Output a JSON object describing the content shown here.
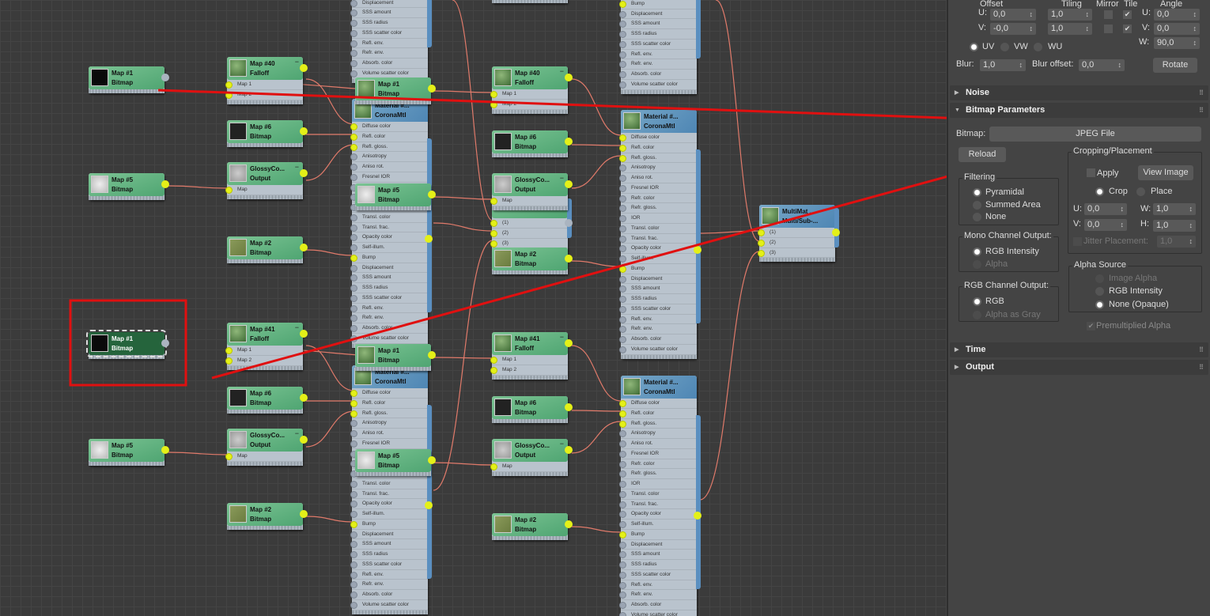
{
  "graph": {
    "material_ports": [
      "Diffuse color",
      "Refl. color",
      "Refl. gloss.",
      "Anisotropy",
      "Aniso rot.",
      "Fresnel IOR",
      "Refr. color",
      "Refr. gloss.",
      "IOR",
      "Transl. color",
      "Transl. frac.",
      "Opacity color",
      "Self-illum.",
      "Bump",
      "Displacement",
      "SSS amount",
      "SSS radius",
      "SSS scatter color",
      "Refl. env.",
      "Refr. env.",
      "Absorb. color",
      "Volume scatter color"
    ],
    "material": {
      "title": "Material #...",
      "subtitle": "CoronaMtl"
    },
    "map1": {
      "title": "Map #1",
      "subtitle": "Bitmap"
    },
    "map5": {
      "title": "Map #5",
      "subtitle": "Bitmap"
    },
    "map6": {
      "title": "Map #6",
      "subtitle": "Bitmap"
    },
    "map2": {
      "title": "Map #2",
      "subtitle": "Bitmap"
    },
    "map40": {
      "title": "Map #40",
      "subtitle": "Falloff",
      "ports": [
        "Map 1",
        "Map 2"
      ]
    },
    "map41": {
      "title": "Map #41",
      "subtitle": "Falloff",
      "ports": [
        "Map 1",
        "Map 2"
      ]
    },
    "glossy": {
      "title": "GlossyCo...",
      "subtitle": "Output",
      "ports": [
        "Map"
      ]
    },
    "multi_ports": [
      "(1)",
      "(2)",
      "(3)"
    ],
    "multimat": {
      "title": "MultiMat ...",
      "subtitle": "Multi/Sub-...",
      "ports": [
        "(1)",
        "(2)",
        "(3)"
      ]
    },
    "wire_color": "#e07a6a",
    "annotation_color": "#e01010"
  },
  "panel": {
    "coords": {
      "offset": "Offset",
      "tiling": "Tiling",
      "mirror": "Mirror",
      "tile": "Tile",
      "angle": "Angle",
      "u_label": "U:",
      "v_label": "V:",
      "w_label": "W:",
      "u_offset": "0,0",
      "v_offset": "-0,0",
      "u_tiling": "1,0",
      "v_tiling": "1,0",
      "u_angle": "0,0",
      "v_angle": "0,0",
      "w_angle": "90,0",
      "uv": "UV",
      "vw": "VW",
      "wu": "WU",
      "blur_label": "Blur:",
      "blur": "1,0",
      "blur_offset_label": "Blur offset:",
      "blur_offset": "0,0",
      "rotate": "Rotate"
    },
    "rollouts": {
      "noise": "Noise",
      "bitmap_parameters": "Bitmap Parameters",
      "time": "Time",
      "output": "Output"
    },
    "bitmap": {
      "label": "Bitmap:",
      "file": "JPEG File",
      "reload": "Reload",
      "filtering": "Filtering",
      "pyramidal": "Pyramidal",
      "summed_area": "Summed Area",
      "none": "None",
      "mono": "Mono Channel Output:",
      "rgb_intensity": "RGB Intensity",
      "alpha": "Alpha",
      "rgb_channel": "RGB Channel Output:",
      "rgb": "RGB",
      "alpha_as_gray": "Alpha as Gray",
      "cropping": "Cropping/Placement",
      "apply": "Apply",
      "view_image": "View Image",
      "crop": "Crop",
      "place": "Place",
      "u_label": "U:",
      "v_label": "V:",
      "w_label": "W:",
      "h_label": "H:",
      "u": "0,0",
      "v": "0,0",
      "w": "1,0",
      "h": "1,0",
      "jitter": "Jitter Placement:",
      "jitter_val": "1,0",
      "alpha_source": "Alpha Source",
      "image_alpha": "Image Alpha",
      "alpha_rgb_intensity": "RGB Intensity",
      "none_opaque": "None (Opaque)",
      "premultiplied": "Premultiplied Alpha"
    }
  }
}
